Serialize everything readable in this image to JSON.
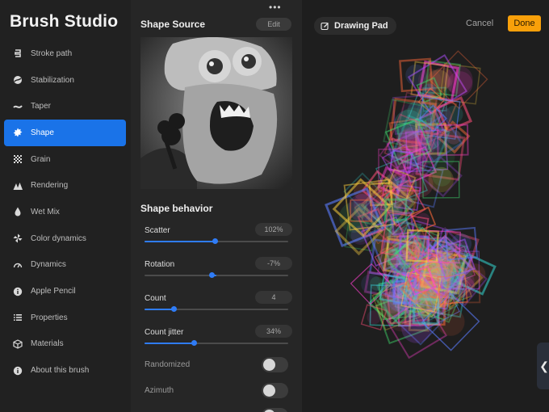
{
  "sidebar": {
    "title": "Brush Studio",
    "items": [
      {
        "label": "Stroke path",
        "icon": "stroke-path-icon"
      },
      {
        "label": "Stabilization",
        "icon": "stabilization-icon"
      },
      {
        "label": "Taper",
        "icon": "taper-icon"
      },
      {
        "label": "Shape",
        "icon": "shape-icon",
        "active": true
      },
      {
        "label": "Grain",
        "icon": "grain-icon"
      },
      {
        "label": "Rendering",
        "icon": "rendering-icon"
      },
      {
        "label": "Wet Mix",
        "icon": "wet-mix-icon"
      },
      {
        "label": "Color dynamics",
        "icon": "color-dynamics-icon"
      },
      {
        "label": "Dynamics",
        "icon": "dynamics-icon"
      },
      {
        "label": "Apple Pencil",
        "icon": "apple-pencil-icon"
      },
      {
        "label": "Properties",
        "icon": "properties-icon"
      },
      {
        "label": "Materials",
        "icon": "materials-icon"
      },
      {
        "label": "About this brush",
        "icon": "info-icon"
      }
    ]
  },
  "panel": {
    "menu_glyph": "•••",
    "shape_source": {
      "title": "Shape Source",
      "edit_label": "Edit"
    },
    "behavior": {
      "title": "Shape behavior",
      "sliders": [
        {
          "label": "Scatter",
          "value": "102%",
          "fraction": 0.49,
          "centered": false
        },
        {
          "label": "Rotation",
          "value": "-7%",
          "fraction": 0.465,
          "centered": true
        },
        {
          "label": "Count",
          "value": "4",
          "fraction": 0.2,
          "centered": false
        },
        {
          "label": "Count jitter",
          "value": "34%",
          "fraction": 0.34,
          "centered": false
        }
      ],
      "toggles": [
        {
          "label": "Randomized",
          "on": false
        },
        {
          "label": "Azimuth",
          "on": false
        }
      ]
    }
  },
  "pad": {
    "label": "Drawing Pad",
    "cancel_label": "Cancel",
    "done_label": "Done",
    "edge_glyph": "❮"
  },
  "colors": {
    "accent": "#1a73e8",
    "slider": "#2f7cf6",
    "done": "#f9a00a"
  }
}
